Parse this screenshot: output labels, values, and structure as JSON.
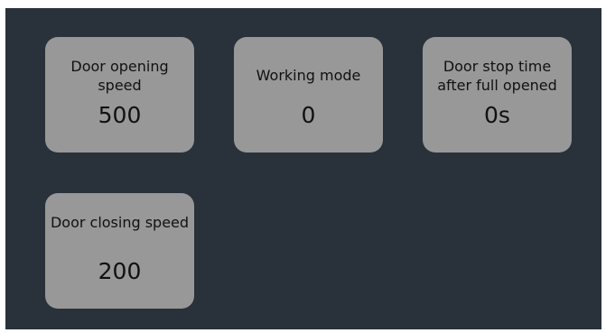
{
  "settings": {
    "opening_speed": {
      "label": "Door opening speed",
      "value": "500"
    },
    "working_mode": {
      "label": "Working mode",
      "value": "0"
    },
    "stop_time": {
      "label": "Door stop time after full opened",
      "value": "0s"
    },
    "closing_speed": {
      "label": "Door closing speed",
      "value": "200"
    }
  }
}
